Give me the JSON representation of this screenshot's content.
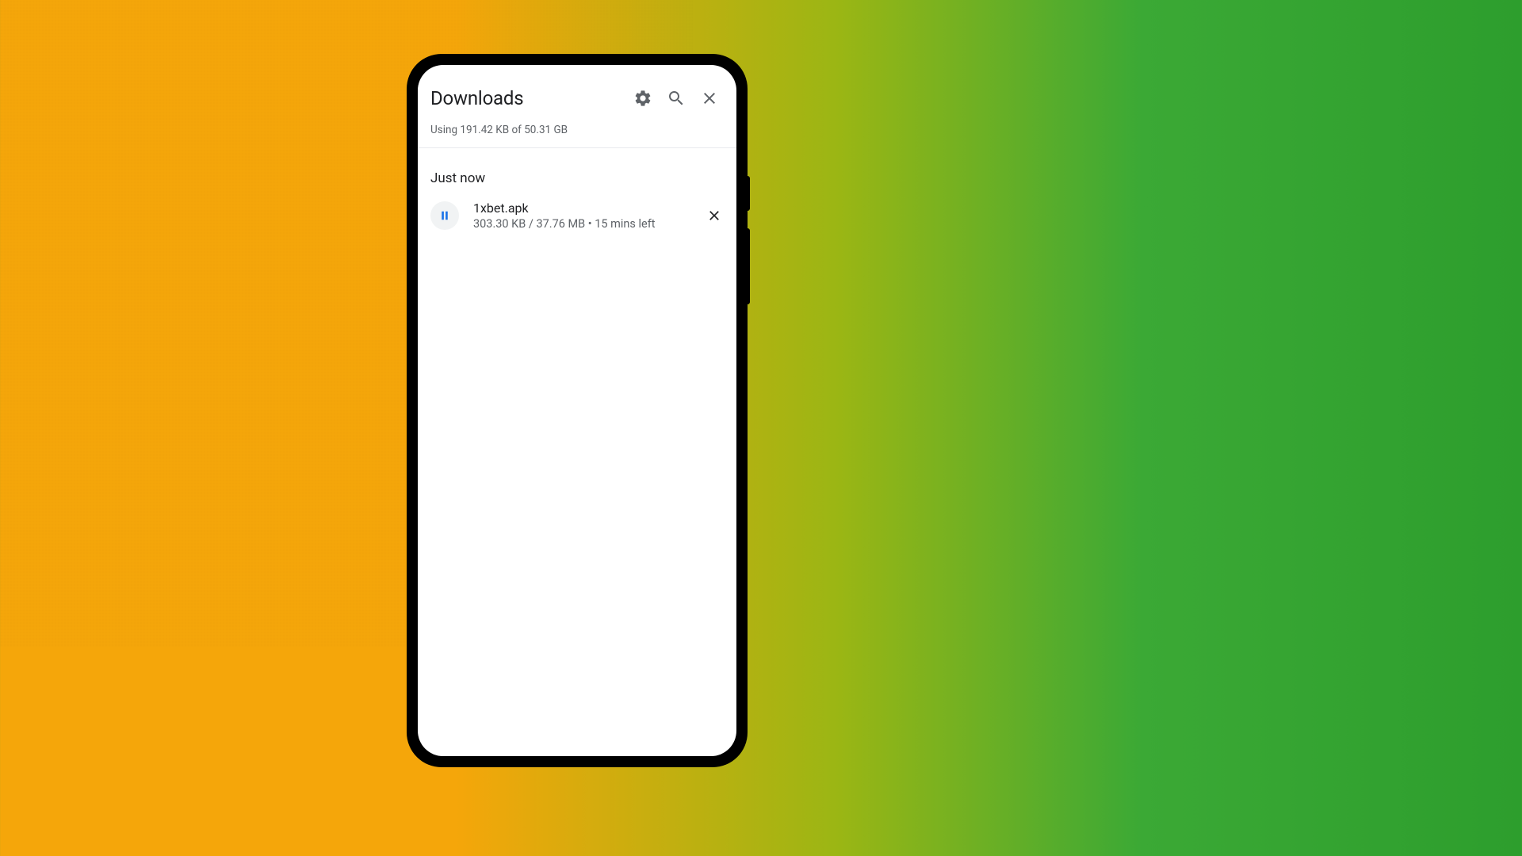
{
  "header": {
    "title": "Downloads"
  },
  "storage": {
    "text": "Using 191.42 KB of 50.31 GB"
  },
  "section": {
    "label": "Just now"
  },
  "downloads": [
    {
      "filename": "1xbet.apk",
      "progress": "303.30 KB / 37.76 MB • 15 mins left"
    }
  ]
}
